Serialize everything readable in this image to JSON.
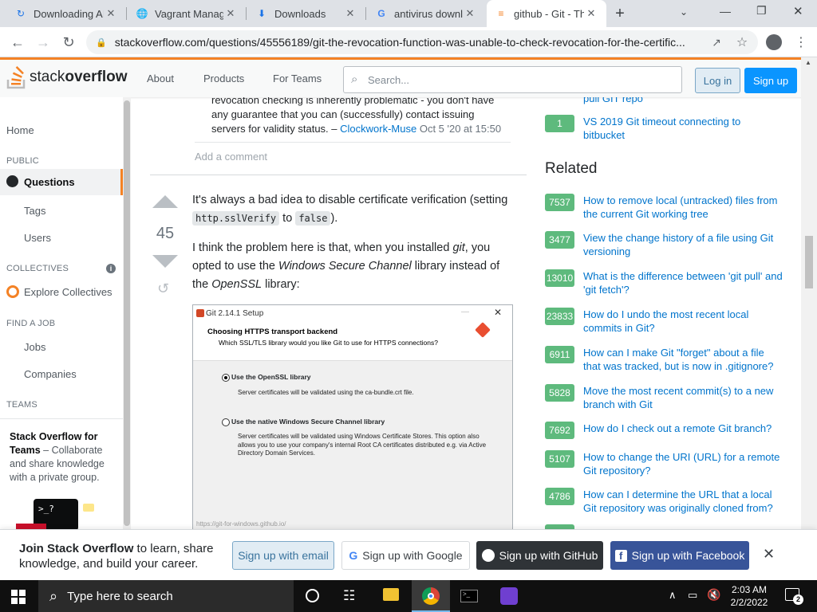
{
  "tabs": [
    {
      "title": "Downloading AI",
      "icon": "refresh-icon"
    },
    {
      "title": "Vagrant Manag",
      "icon": "globe-icon"
    },
    {
      "title": "Downloads",
      "icon": "download-icon"
    },
    {
      "title": "antivirus downl",
      "icon": "google-icon"
    },
    {
      "title": "github - Git - Th",
      "icon": "stackoverflow-icon"
    }
  ],
  "browser": {
    "url": "stackoverflow.com/questions/45556189/git-the-revocation-function-was-unable-to-check-revocation-for-the-certific..."
  },
  "header": {
    "logo_text_1": "stack",
    "logo_text_2": "overflow",
    "nav": [
      "About",
      "Products",
      "For Teams"
    ],
    "search_placeholder": "Search...",
    "login": "Log in",
    "signup": "Sign up"
  },
  "sidebar": {
    "home": "Home",
    "public": "PUBLIC",
    "questions": "Questions",
    "tags": "Tags",
    "users": "Users",
    "collectives": "COLLECTIVES",
    "explore": "Explore Collectives",
    "find_job": "FIND A JOB",
    "jobs": "Jobs",
    "companies": "Companies",
    "teams": "TEAMS",
    "teams_title": "Stack Overflow for Teams",
    "teams_desc": " – Collaborate and share knowledge with a private group."
  },
  "comment": {
    "text": "revocation checking is inherently problematic - you don't have any guarantee that you can (successfully) contact issuing servers for validity status. –",
    "author": "Clockwork-Muse",
    "date": "Oct 5 '20 at 15:50",
    "add": "Add a comment"
  },
  "answer": {
    "votes": "45",
    "p1_a": "It's always a bad idea to disable certificate verification (setting ",
    "p1_code1": "http.sslVerify",
    "p1_b": " to ",
    "p1_code2": "false",
    "p1_c": ").",
    "p2_a": "I think the problem here is that, when you installed ",
    "p2_git": "git",
    "p2_b": ", you opted to use the ",
    "p2_win": "Windows Secure Channel",
    "p2_c": " library instead of the ",
    "p2_ossl": "OpenSSL",
    "p2_d": " library:"
  },
  "screenshot": {
    "title": "Git 2.14.1 Setup",
    "heading": "Choosing HTTPS transport backend",
    "sub": "Which SSL/TLS library would you like Git to use for HTTPS connections?",
    "opt1": "Use the OpenSSL library",
    "opt1_desc": "Server certificates will be validated using the ca-bundle.crt file.",
    "opt2": "Use the native Windows Secure Channel library",
    "opt2_desc": "Server certificates will be validated using Windows Certificate Stores. This option also allows you to use your company's internal Root CA certificates distributed e.g. via Active Directory Domain Services.",
    "footer": "https://git-for-windows.github.io/"
  },
  "linked": [
    {
      "score": "",
      "title": "pull GIT repo"
    },
    {
      "score": "1",
      "title": "VS 2019 Git timeout connecting to bitbucket"
    }
  ],
  "related_title": "Related",
  "related": [
    {
      "score": "7537",
      "title": "How to remove local (untracked) files from the current Git working tree"
    },
    {
      "score": "3477",
      "title": "View the change history of a file using Git versioning"
    },
    {
      "score": "13010",
      "title": "What is the difference between 'git pull' and 'git fetch'?"
    },
    {
      "score": "23833",
      "title": "How do I undo the most recent local commits in Git?"
    },
    {
      "score": "6911",
      "title": "How can I make Git \"forget\" about a file that was tracked, but is now in .gitignore?"
    },
    {
      "score": "5828",
      "title": "Move the most recent commit(s) to a new branch with Git"
    },
    {
      "score": "7692",
      "title": "How do I check out a remote Git branch?"
    },
    {
      "score": "5107",
      "title": "How to change the URI (URL) for a remote Git repository?"
    },
    {
      "score": "4786",
      "title": "How can I determine the URL that a local Git repository was originally cloned from?"
    }
  ],
  "banner": {
    "bold": "Join Stack Overflow",
    "text": " to learn, share knowledge, and build your career.",
    "email": "Sign up with email",
    "google": "Sign up with Google",
    "github": "Sign up with GitHub",
    "facebook": "Sign up with Facebook"
  },
  "taskbar": {
    "search": "Type here to search",
    "time": "2:03 AM",
    "date": "2/2/2022",
    "notifications": "2"
  },
  "colors": {
    "so_orange": "#f48225",
    "vote_green": "#5eba7d",
    "so_blue": "#0a95ff",
    "github": "#2f3337",
    "facebook": "#385499"
  }
}
